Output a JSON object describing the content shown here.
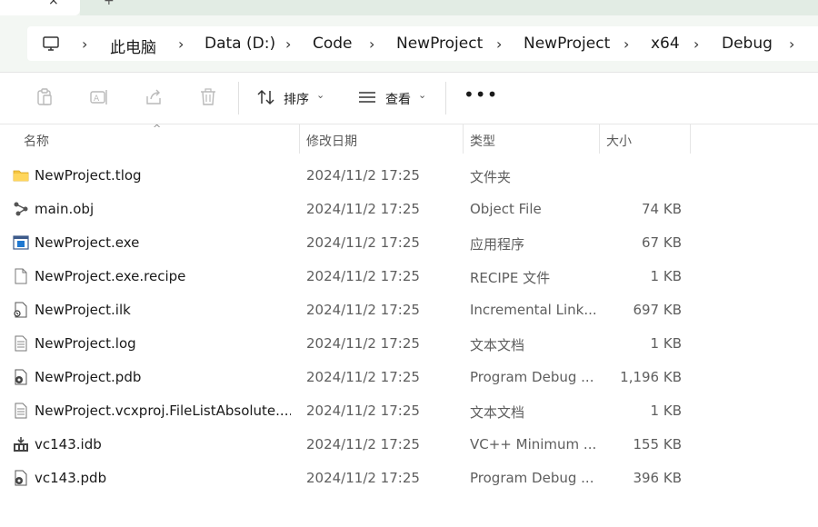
{
  "tabs": {
    "close_glyph": "×",
    "add_glyph": "+"
  },
  "breadcrumb": {
    "icon": "this-pc-icon",
    "items": [
      "此电脑",
      "Data (D:)",
      "Code",
      "NewProject",
      "NewProject",
      "x64",
      "Debug"
    ]
  },
  "toolbar": {
    "sort_label": "排序",
    "view_label": "查看",
    "more_label": "•••",
    "icons": [
      "paste-icon",
      "rename-icon",
      "share-icon",
      "delete-icon"
    ]
  },
  "columns": {
    "name": "名称",
    "modified": "修改日期",
    "type": "类型",
    "size": "大小"
  },
  "files": [
    {
      "name": "NewProject.tlog",
      "modified": "2024/11/2 17:25",
      "type": "文件夹",
      "size": "",
      "icon": "folder-icon"
    },
    {
      "name": "main.obj",
      "modified": "2024/11/2 17:25",
      "type": "Object File",
      "size": "74 KB",
      "icon": "object-file-icon"
    },
    {
      "name": "NewProject.exe",
      "modified": "2024/11/2 17:25",
      "type": "应用程序",
      "size": "67 KB",
      "icon": "application-icon"
    },
    {
      "name": "NewProject.exe.recipe",
      "modified": "2024/11/2 17:25",
      "type": "RECIPE 文件",
      "size": "1 KB",
      "icon": "blank-file-icon"
    },
    {
      "name": "NewProject.ilk",
      "modified": "2024/11/2 17:25",
      "type": "Incremental Link...",
      "size": "697 KB",
      "icon": "link-file-icon"
    },
    {
      "name": "NewProject.log",
      "modified": "2024/11/2 17:25",
      "type": "文本文档",
      "size": "1 KB",
      "icon": "text-file-icon"
    },
    {
      "name": "NewProject.pdb",
      "modified": "2024/11/2 17:25",
      "type": "Program Debug ...",
      "size": "1,196 KB",
      "icon": "debug-database-icon"
    },
    {
      "name": "NewProject.vcxproj.FileListAbsolute....",
      "modified": "2024/11/2 17:25",
      "type": "文本文档",
      "size": "1 KB",
      "icon": "text-file-icon"
    },
    {
      "name": "vc143.idb",
      "modified": "2024/11/2 17:25",
      "type": "VC++ Minimum ...",
      "size": "155 KB",
      "icon": "idb-file-icon"
    },
    {
      "name": "vc143.pdb",
      "modified": "2024/11/2 17:25",
      "type": "Program Debug ...",
      "size": "396 KB",
      "icon": "debug-database-icon"
    }
  ]
}
